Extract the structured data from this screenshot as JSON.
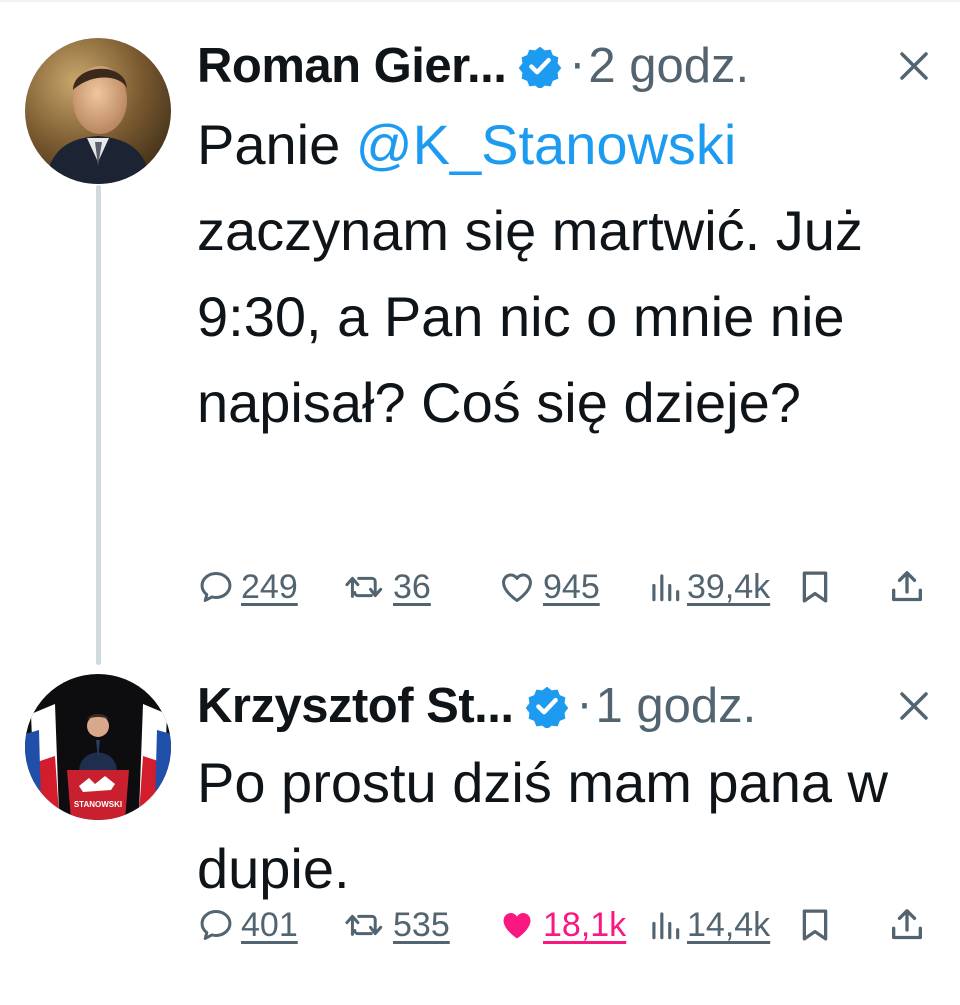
{
  "tweets": [
    {
      "author_name": "Roman Gier...",
      "time": "2 godz.",
      "separator": "·",
      "text_prefix": "Panie ",
      "mention": "@K_Stanowski",
      "text_rest": " zaczynam się martwić. Już 9:30, a Pan nic o mnie nie napisał? Coś się dzieje?",
      "replies": "249",
      "retweets": "36",
      "likes": "945",
      "views": "39,4k",
      "liked": false
    },
    {
      "author_name": "Krzysztof St...",
      "time": "1 godz.",
      "separator": "·",
      "text": "Po prostu dziś mam pana w dupie.",
      "avatar_podium_text": "STANOWSKI",
      "replies": "401",
      "retweets": "535",
      "likes": "18,1k",
      "views": "14,4k",
      "liked": true
    }
  ],
  "icons": {
    "reply": "reply-icon",
    "retweet": "retweet-icon",
    "like": "heart-icon",
    "views": "views-icon",
    "bookmark": "bookmark-icon",
    "share": "share-icon",
    "verified": "verified-badge-icon",
    "close": "close-icon"
  },
  "colors": {
    "text": "#0f1419",
    "secondary": "#536471",
    "mention": "#1d9bf0",
    "verified": "#1d9bf0",
    "like_active": "#f91880",
    "thread_line": "#cfd9de"
  }
}
